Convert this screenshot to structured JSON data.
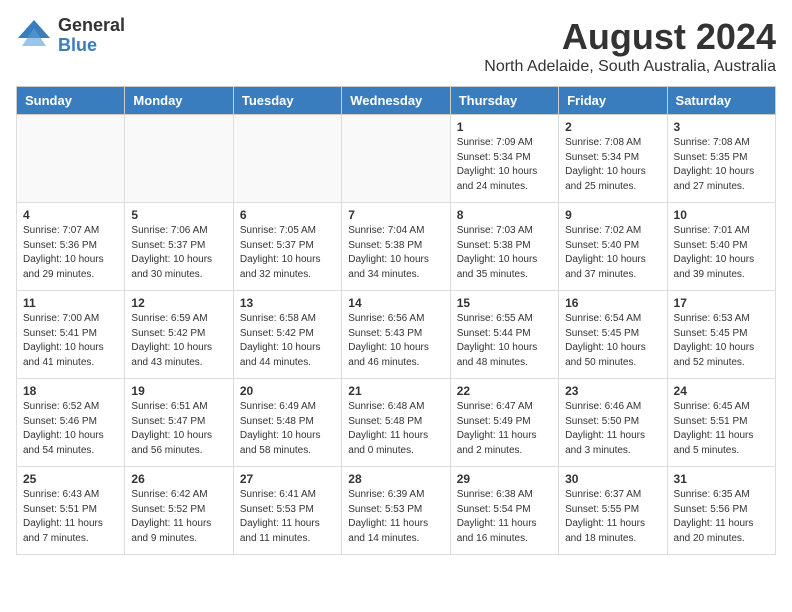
{
  "header": {
    "logo_general": "General",
    "logo_blue": "Blue",
    "month_title": "August 2024",
    "location": "North Adelaide, South Australia, Australia"
  },
  "weekdays": [
    "Sunday",
    "Monday",
    "Tuesday",
    "Wednesday",
    "Thursday",
    "Friday",
    "Saturday"
  ],
  "weeks": [
    [
      {
        "day": "",
        "info": "",
        "empty": true
      },
      {
        "day": "",
        "info": "",
        "empty": true
      },
      {
        "day": "",
        "info": "",
        "empty": true
      },
      {
        "day": "",
        "info": "",
        "empty": true
      },
      {
        "day": "1",
        "info": "Sunrise: 7:09 AM\nSunset: 5:34 PM\nDaylight: 10 hours\nand 24 minutes.",
        "empty": false
      },
      {
        "day": "2",
        "info": "Sunrise: 7:08 AM\nSunset: 5:34 PM\nDaylight: 10 hours\nand 25 minutes.",
        "empty": false
      },
      {
        "day": "3",
        "info": "Sunrise: 7:08 AM\nSunset: 5:35 PM\nDaylight: 10 hours\nand 27 minutes.",
        "empty": false
      }
    ],
    [
      {
        "day": "4",
        "info": "Sunrise: 7:07 AM\nSunset: 5:36 PM\nDaylight: 10 hours\nand 29 minutes.",
        "empty": false
      },
      {
        "day": "5",
        "info": "Sunrise: 7:06 AM\nSunset: 5:37 PM\nDaylight: 10 hours\nand 30 minutes.",
        "empty": false
      },
      {
        "day": "6",
        "info": "Sunrise: 7:05 AM\nSunset: 5:37 PM\nDaylight: 10 hours\nand 32 minutes.",
        "empty": false
      },
      {
        "day": "7",
        "info": "Sunrise: 7:04 AM\nSunset: 5:38 PM\nDaylight: 10 hours\nand 34 minutes.",
        "empty": false
      },
      {
        "day": "8",
        "info": "Sunrise: 7:03 AM\nSunset: 5:38 PM\nDaylight: 10 hours\nand 35 minutes.",
        "empty": false
      },
      {
        "day": "9",
        "info": "Sunrise: 7:02 AM\nSunset: 5:40 PM\nDaylight: 10 hours\nand 37 minutes.",
        "empty": false
      },
      {
        "day": "10",
        "info": "Sunrise: 7:01 AM\nSunset: 5:40 PM\nDaylight: 10 hours\nand 39 minutes.",
        "empty": false
      }
    ],
    [
      {
        "day": "11",
        "info": "Sunrise: 7:00 AM\nSunset: 5:41 PM\nDaylight: 10 hours\nand 41 minutes.",
        "empty": false
      },
      {
        "day": "12",
        "info": "Sunrise: 6:59 AM\nSunset: 5:42 PM\nDaylight: 10 hours\nand 43 minutes.",
        "empty": false
      },
      {
        "day": "13",
        "info": "Sunrise: 6:58 AM\nSunset: 5:42 PM\nDaylight: 10 hours\nand 44 minutes.",
        "empty": false
      },
      {
        "day": "14",
        "info": "Sunrise: 6:56 AM\nSunset: 5:43 PM\nDaylight: 10 hours\nand 46 minutes.",
        "empty": false
      },
      {
        "day": "15",
        "info": "Sunrise: 6:55 AM\nSunset: 5:44 PM\nDaylight: 10 hours\nand 48 minutes.",
        "empty": false
      },
      {
        "day": "16",
        "info": "Sunrise: 6:54 AM\nSunset: 5:45 PM\nDaylight: 10 hours\nand 50 minutes.",
        "empty": false
      },
      {
        "day": "17",
        "info": "Sunrise: 6:53 AM\nSunset: 5:45 PM\nDaylight: 10 hours\nand 52 minutes.",
        "empty": false
      }
    ],
    [
      {
        "day": "18",
        "info": "Sunrise: 6:52 AM\nSunset: 5:46 PM\nDaylight: 10 hours\nand 54 minutes.",
        "empty": false
      },
      {
        "day": "19",
        "info": "Sunrise: 6:51 AM\nSunset: 5:47 PM\nDaylight: 10 hours\nand 56 minutes.",
        "empty": false
      },
      {
        "day": "20",
        "info": "Sunrise: 6:49 AM\nSunset: 5:48 PM\nDaylight: 10 hours\nand 58 minutes.",
        "empty": false
      },
      {
        "day": "21",
        "info": "Sunrise: 6:48 AM\nSunset: 5:48 PM\nDaylight: 11 hours\nand 0 minutes.",
        "empty": false
      },
      {
        "day": "22",
        "info": "Sunrise: 6:47 AM\nSunset: 5:49 PM\nDaylight: 11 hours\nand 2 minutes.",
        "empty": false
      },
      {
        "day": "23",
        "info": "Sunrise: 6:46 AM\nSunset: 5:50 PM\nDaylight: 11 hours\nand 3 minutes.",
        "empty": false
      },
      {
        "day": "24",
        "info": "Sunrise: 6:45 AM\nSunset: 5:51 PM\nDaylight: 11 hours\nand 5 minutes.",
        "empty": false
      }
    ],
    [
      {
        "day": "25",
        "info": "Sunrise: 6:43 AM\nSunset: 5:51 PM\nDaylight: 11 hours\nand 7 minutes.",
        "empty": false
      },
      {
        "day": "26",
        "info": "Sunrise: 6:42 AM\nSunset: 5:52 PM\nDaylight: 11 hours\nand 9 minutes.",
        "empty": false
      },
      {
        "day": "27",
        "info": "Sunrise: 6:41 AM\nSunset: 5:53 PM\nDaylight: 11 hours\nand 11 minutes.",
        "empty": false
      },
      {
        "day": "28",
        "info": "Sunrise: 6:39 AM\nSunset: 5:53 PM\nDaylight: 11 hours\nand 14 minutes.",
        "empty": false
      },
      {
        "day": "29",
        "info": "Sunrise: 6:38 AM\nSunset: 5:54 PM\nDaylight: 11 hours\nand 16 minutes.",
        "empty": false
      },
      {
        "day": "30",
        "info": "Sunrise: 6:37 AM\nSunset: 5:55 PM\nDaylight: 11 hours\nand 18 minutes.",
        "empty": false
      },
      {
        "day": "31",
        "info": "Sunrise: 6:35 AM\nSunset: 5:56 PM\nDaylight: 11 hours\nand 20 minutes.",
        "empty": false
      }
    ]
  ]
}
